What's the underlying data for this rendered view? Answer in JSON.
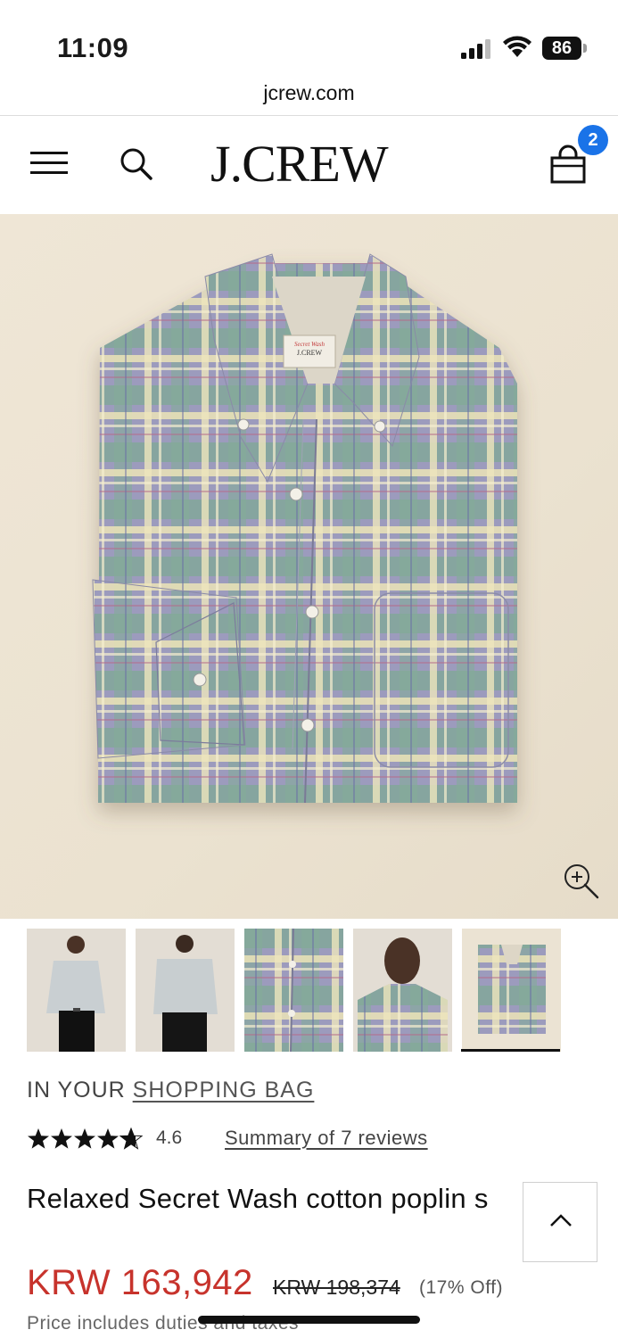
{
  "status_bar": {
    "time": "11:09",
    "battery": "86"
  },
  "browser": {
    "url": "jcrew.com"
  },
  "header": {
    "logo": "J.CREW",
    "bag_count": "2"
  },
  "product": {
    "in_bag_prefix": "IN YOUR ",
    "in_bag_link": "SHOPPING BAG",
    "rating": "4.6",
    "reviews_link": "Summary of 7 reviews",
    "title": "Relaxed Secret Wash cotton poplin s",
    "price_sale": "KRW 163,942",
    "price_original": "KRW 198,374",
    "discount": "(17% Off)",
    "price_note": "Price includes duties and taxes",
    "label_tag_line1": "Secret Wash",
    "label_tag_line2": "J.CREW"
  },
  "thumbnails": [
    {
      "name": "front-model"
    },
    {
      "name": "back-model"
    },
    {
      "name": "fabric-detail"
    },
    {
      "name": "closeup-model"
    },
    {
      "name": "folded-shirt",
      "active": true
    }
  ],
  "colors": {
    "sale_red": "#c7332c",
    "badge_blue": "#1a73e8"
  }
}
